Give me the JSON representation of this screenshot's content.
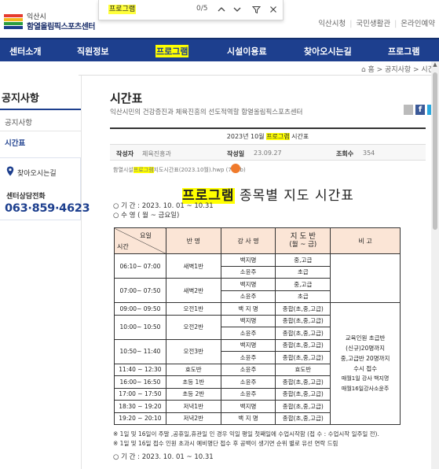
{
  "header": {
    "logo_line1": "익산시",
    "logo_line2": "함열올림픽스포츠센터",
    "links": [
      "익산시청",
      "국민생활관",
      "온라인예약"
    ]
  },
  "find": {
    "query": "프로그램",
    "count": "0/5"
  },
  "nav": {
    "items": [
      "센터소개",
      "직원정보",
      "프로그램",
      "시설이용료",
      "찾아오시는길",
      "프로그램"
    ]
  },
  "breadcrumb": "⌂ 홈 > 공지사항 > 시간",
  "sidebar": {
    "title": "공지사항",
    "items": [
      "공지사항",
      "시간표"
    ],
    "location_label": "찾아오시는길",
    "phone_label": "센터상담전화",
    "phone": "063·859·4623"
  },
  "main": {
    "title": "시간표",
    "desc": "익산시민의 건강증진과 체육진흥의 선도적역할 함열올림픽스포츠센터"
  },
  "board": {
    "title_pre": "2023년 10월 ",
    "title_hl": "프로그램",
    "title_post": " 시간표",
    "author_label": "작성자",
    "author": "체육진흥과",
    "date_label": "작성일",
    "date": "23.09.27",
    "views_label": "조회수",
    "views": "354",
    "attach_pre": "함열시설",
    "attach_hl": "프로그램",
    "attach_post": "지도시간표(2023.10월).hwp (72 kb)"
  },
  "doc": {
    "title_hl": "프로그램",
    "title_rest": " 종목별 지도 시간표",
    "period": "○ 기 간 : 2023. 10. 01 ~ 10.31",
    "days": "○ 수 영 ( 월 ~ 금요일)",
    "head_day": "요일",
    "head_time": "시간",
    "head_class": "반 명",
    "head_teacher": "강 사 명",
    "head_level_1": "지 도 반",
    "head_level_2": "(월 ~ 금)",
    "head_note": "비 고",
    "rows": [
      {
        "time": "06:10~ 07:00",
        "cls": "새벽1반",
        "teacher": "백지명",
        "level": "중,고급",
        "blue": true
      },
      {
        "time": "",
        "cls": "",
        "teacher": "소윤주",
        "level": "초급",
        "blue": true
      },
      {
        "time": "07:00~ 07:50",
        "cls": "새벽2반",
        "teacher": "백지명",
        "level": "중,고급",
        "blue": true
      },
      {
        "time": "",
        "cls": "",
        "teacher": "소윤주",
        "level": "초급",
        "blue": true
      },
      {
        "time": "09:00~ 09:50",
        "cls": "오전1반",
        "teacher": "백 지 명",
        "level": "종합(초,중,고급)",
        "blue": false
      },
      {
        "time": "10:00~ 10:50",
        "cls": "오전2반",
        "teacher": "백지명",
        "level": "종합(초,중,고급)",
        "blue": false
      },
      {
        "time": "",
        "cls": "",
        "teacher": "소윤주",
        "level": "종합(초,중,고급)",
        "blue": false
      },
      {
        "time": "10:50~ 11:40",
        "cls": "오전3반",
        "teacher": "백지명",
        "level": "종합(초,중,고급)",
        "blue": false
      },
      {
        "time": "",
        "cls": "",
        "teacher": "소윤주",
        "level": "종합(초,중,고급)",
        "blue": false
      },
      {
        "time": "11:40 ~ 12:30",
        "cls": "효도반",
        "teacher": "소윤주",
        "level": "효도반",
        "blue": false
      },
      {
        "time": "16:00~ 16:50",
        "cls": "초등 1반",
        "teacher": "소윤주",
        "level": "종합(초,중,고급)",
        "blue": false
      },
      {
        "time": "17:00 ~ 17:50",
        "cls": "초등 2반",
        "teacher": "소윤주",
        "level": "종합(초,중,고급)",
        "blue": false
      },
      {
        "time": "18:30 ~ 19:20",
        "cls": "저녁1반",
        "teacher": "백지명",
        "level": "종합(초,중,고급)",
        "blue": false
      },
      {
        "time": "19:20 ~ 20:10",
        "cls": "저녁2반",
        "teacher": "백 지 명",
        "level": "종합(초,중,고급)",
        "blue": false
      }
    ],
    "note_lines": [
      "교육인원 초급반",
      "(신규)20명까지",
      "중,고급반 20명까지",
      "수시 접수",
      "매월1일 강사 백지명",
      "매월16일강사소윤주"
    ],
    "foot1": "※ 1일 및 16일이 주말 ,공휴일,휴관일 인 경우 익일 평일 첫째일에 수업시작함 (접 수 : 수업시작 일주일 전).",
    "foot2": "※ 1일 및 16일 접수 인원 초과시 예비명단 접수 후 공백이 생기면 순위 별로 유선 연락 드림",
    "period2": "○ 기 간 : 2023. 10. 01 ~ 10.31"
  }
}
